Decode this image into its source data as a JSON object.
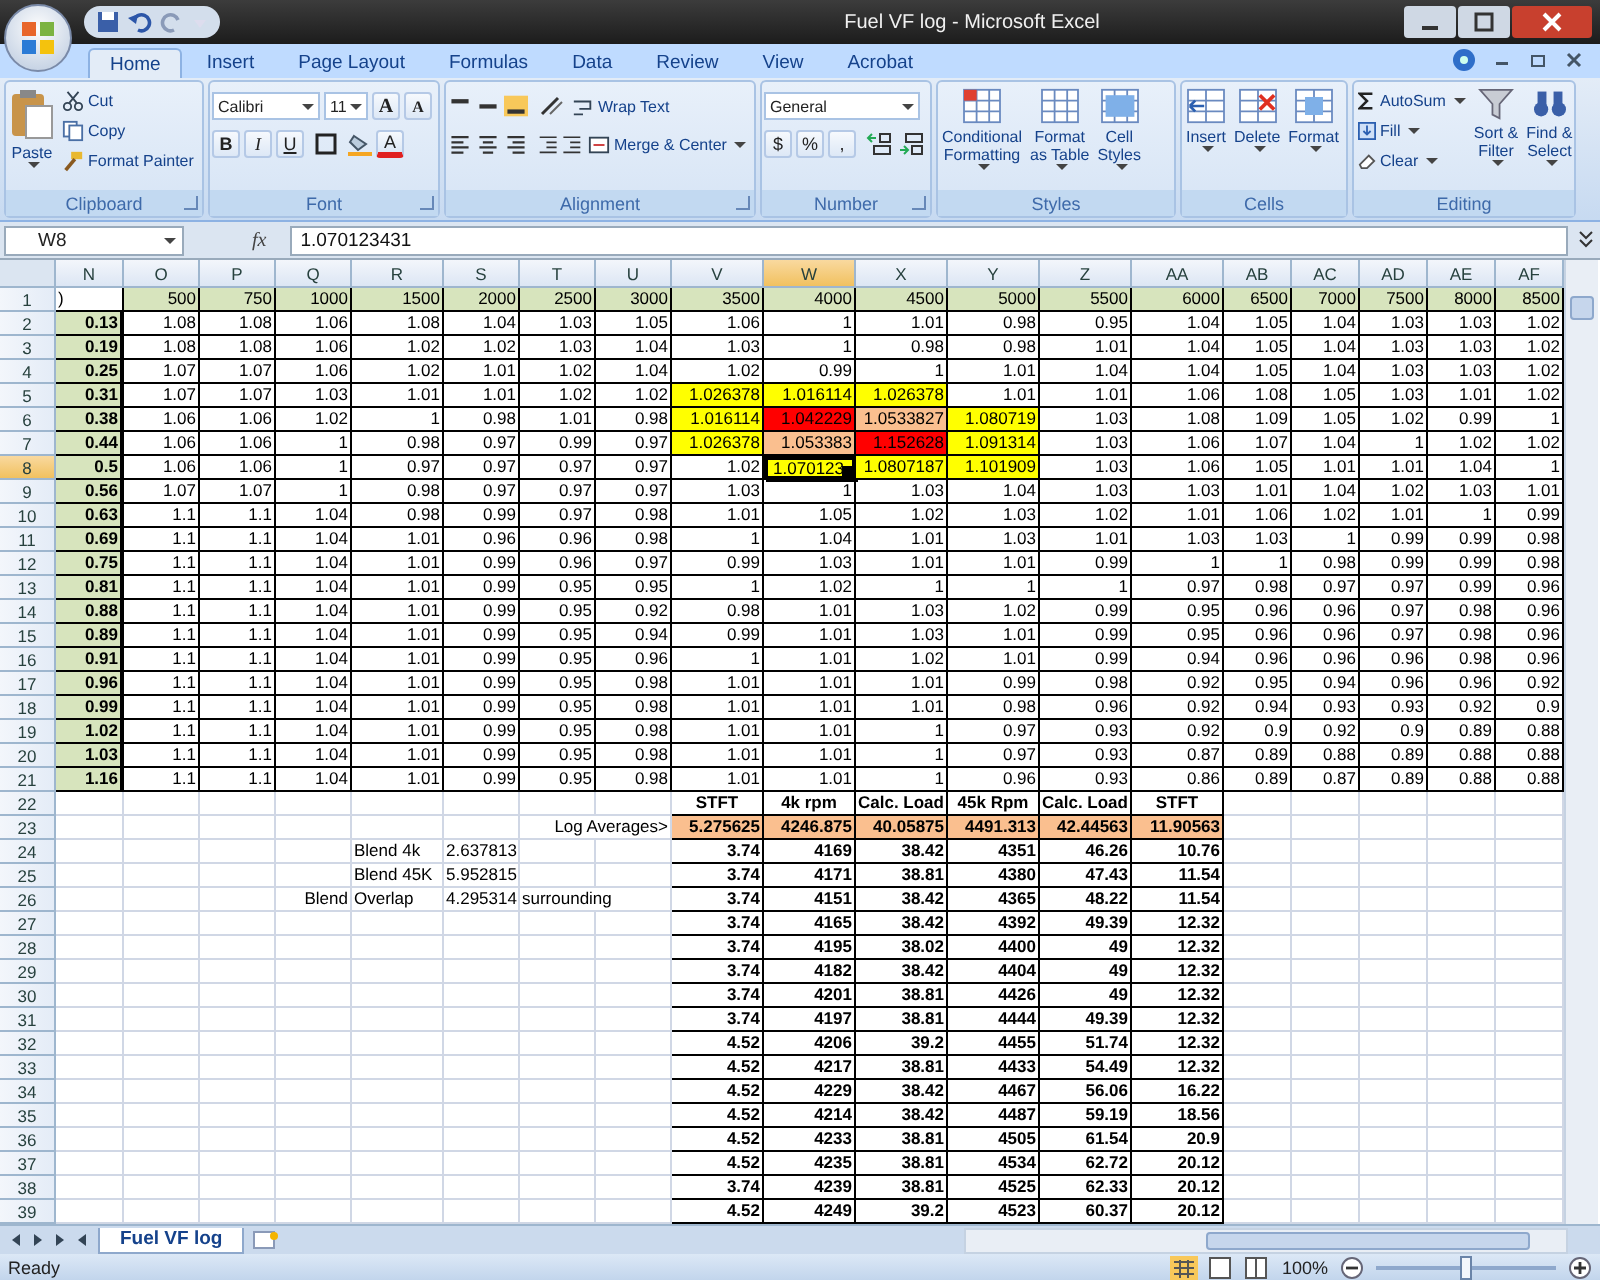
{
  "window": {
    "title": "Fuel VF log - Microsoft Excel"
  },
  "tabs": [
    {
      "label": "Home",
      "selected": true
    },
    {
      "label": "Insert",
      "selected": false
    },
    {
      "label": "Page Layout",
      "selected": false
    },
    {
      "label": "Formulas",
      "selected": false
    },
    {
      "label": "Data",
      "selected": false
    },
    {
      "label": "Review",
      "selected": false
    },
    {
      "label": "View",
      "selected": false
    },
    {
      "label": "Acrobat",
      "selected": false
    }
  ],
  "ribbon": {
    "clipboard": {
      "label": "Clipboard",
      "paste": "Paste",
      "cut": "Cut",
      "copy": "Copy",
      "format_painter": "Format Painter"
    },
    "font": {
      "label": "Font",
      "family": "Calibri",
      "size": "11",
      "grow": "A",
      "shrink": "A",
      "bold": "B",
      "italic": "I",
      "underline": "U",
      "font_color": "A"
    },
    "alignment": {
      "label": "Alignment",
      "valign": [
        {
          "selected": false
        },
        {
          "selected": false
        },
        {
          "selected": true
        }
      ],
      "wrap": "Wrap Text",
      "merge": "Merge & Center"
    },
    "number": {
      "label": "Number",
      "format": "General",
      "currency": "$",
      "percent": "%",
      "comma": ","
    },
    "styles": {
      "label": "Styles",
      "buttons": [
        [
          "Conditional",
          "Formatting"
        ],
        [
          "Format",
          "as Table"
        ],
        [
          "Cell",
          "Styles"
        ]
      ]
    },
    "cells": {
      "label": "Cells",
      "buttons": [
        "Insert",
        "Delete",
        "Format"
      ]
    },
    "editing": {
      "label": "Editing",
      "autosum": "AutoSum",
      "fill": "Fill",
      "clear": "Clear",
      "buttons": [
        [
          "Sort &",
          "Filter"
        ],
        [
          "Find &",
          "Select"
        ]
      ]
    }
  },
  "formula_bar": {
    "name_box": "W8",
    "fx": "fx",
    "formula": "1.070123431"
  },
  "sheet": {
    "columns": [
      "N",
      "O",
      "P",
      "Q",
      "R",
      "S",
      "T",
      "U",
      "V",
      "W",
      "X",
      "Y",
      "Z",
      "AA",
      "AB",
      "AC",
      "AD",
      "AE",
      "AF"
    ],
    "row_numbers": [
      "1",
      "2",
      "3",
      "4",
      "5",
      "6",
      "7",
      "8",
      "9",
      "10",
      "11",
      "12",
      "13",
      "14",
      "15",
      "16",
      "17",
      "18",
      "19",
      "20",
      "21",
      "22",
      "23",
      "24",
      "25",
      "26",
      "27",
      "28",
      "29",
      "30",
      "31",
      "32",
      "33",
      "34",
      "35",
      "36",
      "37",
      "38",
      "39"
    ]
  },
  "grid": {
    "corner": ")",
    "headers": [
      "500",
      "750",
      "1000",
      "1500",
      "2000",
      "2500",
      "3000",
      "3500",
      "4000",
      "4500",
      "5000",
      "5500",
      "6000",
      "6500",
      "7000",
      "7500",
      "8000",
      "8500"
    ],
    "rows": [
      {
        "key": "0.13",
        "values": [
          "1.08",
          "1.08",
          "1.06",
          "1.08",
          "1.04",
          "1.03",
          "1.05",
          "1.06",
          "1",
          "1.01",
          "0.98",
          "0.95",
          "1.04",
          "1.05",
          "1.04",
          "1.03",
          "1.03",
          "1.02"
        ]
      },
      {
        "key": "0.19",
        "values": [
          "1.08",
          "1.08",
          "1.06",
          "1.02",
          "1.02",
          "1.03",
          "1.04",
          "1.03",
          "1",
          "0.98",
          "0.98",
          "1.01",
          "1.04",
          "1.05",
          "1.04",
          "1.03",
          "1.03",
          "1.02"
        ]
      },
      {
        "key": "0.25",
        "values": [
          "1.07",
          "1.07",
          "1.06",
          "1.02",
          "1.01",
          "1.02",
          "1.04",
          "1.02",
          "0.99",
          "1",
          "1.01",
          "1.04",
          "1.04",
          "1.05",
          "1.04",
          "1.03",
          "1.03",
          "1.02"
        ]
      },
      {
        "key": "0.31",
        "values": [
          "1.07",
          "1.07",
          "1.03",
          "1.01",
          "1.01",
          "1.02",
          "1.02",
          {
            "text": "1.026378",
            "color": "#ffff00"
          },
          {
            "text": "1.016114",
            "color": "#ffff00"
          },
          {
            "text": "1.026378",
            "color": "#ffff00"
          },
          "1.01",
          "1.01",
          "1.06",
          "1.08",
          "1.05",
          "1.03",
          "1.01",
          "1.02"
        ]
      },
      {
        "key": "0.38",
        "values": [
          "1.06",
          "1.06",
          "1.02",
          "1",
          "0.98",
          "1.01",
          "0.98",
          {
            "text": "1.016114",
            "color": "#ffff00"
          },
          {
            "text": "1.042229",
            "color": "#ff0000"
          },
          {
            "text": "1.0533827",
            "color": "#fabf8f"
          },
          {
            "text": "1.080719",
            "color": "#ffff00"
          },
          "1.03",
          "1.08",
          "1.09",
          "1.05",
          "1.02",
          "0.99",
          "1"
        ]
      },
      {
        "key": "0.44",
        "values": [
          "1.06",
          "1.06",
          "1",
          "0.98",
          "0.97",
          "0.99",
          "0.97",
          {
            "text": "1.026378",
            "color": "#ffff00"
          },
          {
            "text": "1.053383",
            "color": "#fabf8f"
          },
          {
            "text": "1.152628",
            "color": "#ff0000"
          },
          {
            "text": "1.091314",
            "color": "#ffff00"
          },
          "1.03",
          "1.06",
          "1.07",
          "1.04",
          "1",
          "1.02",
          "1.02"
        ]
      },
      {
        "key": "0.5",
        "values": [
          "1.06",
          "1.06",
          "1",
          "0.97",
          "0.97",
          "0.97",
          "0.97",
          "1.02",
          {
            "text": "1.070123",
            "color": "#ffff00",
            "selected": true
          },
          {
            "text": "1.0807187",
            "color": "#ffff00"
          },
          {
            "text": "1.101909",
            "color": "#ffff00"
          },
          "1.03",
          "1.06",
          "1.05",
          "1.01",
          "1.01",
          "1.04",
          "1"
        ]
      },
      {
        "key": "0.56",
        "values": [
          "1.07",
          "1.07",
          "1",
          "0.98",
          "0.97",
          "0.97",
          "0.97",
          "1.03",
          "1",
          "1.03",
          "1.04",
          "1.03",
          "1.03",
          "1.01",
          "1.04",
          "1.02",
          "1.03",
          "1.01"
        ]
      },
      {
        "key": "0.63",
        "values": [
          "1.1",
          "1.1",
          "1.04",
          "0.98",
          "0.99",
          "0.97",
          "0.98",
          "1.01",
          "1.05",
          "1.02",
          "1.03",
          "1.02",
          "1.01",
          "1.06",
          "1.02",
          "1.01",
          "1",
          "0.99"
        ]
      },
      {
        "key": "0.69",
        "values": [
          "1.1",
          "1.1",
          "1.04",
          "1.01",
          "0.96",
          "0.96",
          "0.98",
          "1",
          "1.04",
          "1.01",
          "1.03",
          "1.01",
          "1.03",
          "1.03",
          "1",
          "0.99",
          "0.99",
          "0.98"
        ]
      },
      {
        "key": "0.75",
        "values": [
          "1.1",
          "1.1",
          "1.04",
          "1.01",
          "0.99",
          "0.96",
          "0.97",
          "0.99",
          "1.03",
          "1.01",
          "1.01",
          "0.99",
          "1",
          "1",
          "0.98",
          "0.99",
          "0.99",
          "0.98"
        ]
      },
      {
        "key": "0.81",
        "values": [
          "1.1",
          "1.1",
          "1.04",
          "1.01",
          "0.99",
          "0.95",
          "0.95",
          "1",
          "1.02",
          "1",
          "1",
          "1",
          "0.97",
          "0.98",
          "0.97",
          "0.97",
          "0.99",
          "0.96"
        ]
      },
      {
        "key": "0.88",
        "values": [
          "1.1",
          "1.1",
          "1.04",
          "1.01",
          "0.99",
          "0.95",
          "0.92",
          "0.98",
          "1.01",
          "1.03",
          "1.02",
          "0.99",
          "0.95",
          "0.96",
          "0.96",
          "0.97",
          "0.98",
          "0.96"
        ]
      },
      {
        "key": "0.89",
        "values": [
          "1.1",
          "1.1",
          "1.04",
          "1.01",
          "0.99",
          "0.95",
          "0.94",
          "0.99",
          "1.01",
          "1.03",
          "1.01",
          "0.99",
          "0.95",
          "0.96",
          "0.96",
          "0.97",
          "0.98",
          "0.96"
        ]
      },
      {
        "key": "0.91",
        "values": [
          "1.1",
          "1.1",
          "1.04",
          "1.01",
          "0.99",
          "0.95",
          "0.96",
          "1",
          "1.01",
          "1.02",
          "1.01",
          "0.99",
          "0.94",
          "0.96",
          "0.96",
          "0.96",
          "0.98",
          "0.96"
        ]
      },
      {
        "key": "0.96",
        "values": [
          "1.1",
          "1.1",
          "1.04",
          "1.01",
          "0.99",
          "0.95",
          "0.98",
          "1.01",
          "1.01",
          "1.01",
          "0.99",
          "0.98",
          "0.92",
          "0.95",
          "0.94",
          "0.96",
          "0.96",
          "0.92"
        ]
      },
      {
        "key": "0.99",
        "values": [
          "1.1",
          "1.1",
          "1.04",
          "1.01",
          "0.99",
          "0.95",
          "0.98",
          "1.01",
          "1.01",
          "1.01",
          "0.98",
          "0.96",
          "0.92",
          "0.94",
          "0.93",
          "0.93",
          "0.92",
          "0.9"
        ]
      },
      {
        "key": "1.02",
        "values": [
          "1.1",
          "1.1",
          "1.04",
          "1.01",
          "0.99",
          "0.95",
          "0.98",
          "1.01",
          "1.01",
          "1",
          "0.97",
          "0.93",
          "0.92",
          "0.9",
          "0.92",
          "0.9",
          "0.89",
          "0.88"
        ]
      },
      {
        "key": "1.03",
        "values": [
          "1.1",
          "1.1",
          "1.04",
          "1.01",
          "0.99",
          "0.95",
          "0.98",
          "1.01",
          "1.01",
          "1",
          "0.97",
          "0.93",
          "0.87",
          "0.89",
          "0.88",
          "0.89",
          "0.88",
          "0.88"
        ]
      },
      {
        "key": "1.16",
        "values": [
          "1.1",
          "1.1",
          "1.04",
          "1.01",
          "0.99",
          "0.95",
          "0.98",
          "1.01",
          "1.01",
          "1",
          "0.96",
          "0.93",
          "0.86",
          "0.89",
          "0.87",
          "0.89",
          "0.88",
          "0.88"
        ]
      }
    ]
  },
  "log": {
    "columns": [
      "STFT",
      "4k rpm",
      "Calc. Load",
      "45k Rpm",
      "Calc. Load",
      "STFT"
    ],
    "averages_label": "Log Averages>",
    "averages": [
      "5.275625",
      "4246.875",
      "40.05875",
      "4491.313",
      "42.44563",
      "11.90563"
    ],
    "rows": [
      [
        "3.74",
        "4169",
        "38.42",
        "4351",
        "46.26",
        "10.76"
      ],
      [
        "3.74",
        "4171",
        "38.81",
        "4380",
        "47.43",
        "11.54"
      ],
      [
        "3.74",
        "4151",
        "38.42",
        "4365",
        "48.22",
        "11.54"
      ],
      [
        "3.74",
        "4165",
        "38.42",
        "4392",
        "49.39",
        "12.32"
      ],
      [
        "3.74",
        "4195",
        "38.02",
        "4400",
        "49",
        "12.32"
      ],
      [
        "3.74",
        "4182",
        "38.42",
        "4404",
        "49",
        "12.32"
      ],
      [
        "3.74",
        "4201",
        "38.81",
        "4426",
        "49",
        "12.32"
      ],
      [
        "3.74",
        "4197",
        "38.81",
        "4444",
        "49.39",
        "12.32"
      ],
      [
        "4.52",
        "4206",
        "39.2",
        "4455",
        "51.74",
        "12.32"
      ],
      [
        "4.52",
        "4217",
        "38.81",
        "4433",
        "54.49",
        "12.32"
      ],
      [
        "4.52",
        "4229",
        "38.42",
        "4467",
        "56.06",
        "16.22"
      ],
      [
        "4.52",
        "4214",
        "38.42",
        "4487",
        "59.19",
        "18.56"
      ],
      [
        "4.52",
        "4233",
        "38.81",
        "4505",
        "61.54",
        "20.9"
      ],
      [
        "4.52",
        "4235",
        "38.81",
        "4534",
        "62.72",
        "20.12"
      ],
      [
        "3.74",
        "4239",
        "38.81",
        "4525",
        "62.33",
        "20.12"
      ],
      [
        "4.52",
        "4249",
        "39.2",
        "4523",
        "60.37",
        "20.12"
      ]
    ]
  },
  "notes": [
    {
      "label": "Blend 4k",
      "value": "2.637813"
    },
    {
      "label": "Blend 45K",
      "value": "5.952815"
    },
    {
      "prefix": "Blend",
      "label": "Overlap",
      "value": "4.295314",
      "suffix": "surrounding"
    }
  ],
  "sheet_tabs": [
    {
      "label": "Fuel VF log",
      "selected": true
    }
  ],
  "status_bar": {
    "text": "Ready",
    "zoom": "100%",
    "zoom_slider": {
      "level": 0.5
    }
  }
}
